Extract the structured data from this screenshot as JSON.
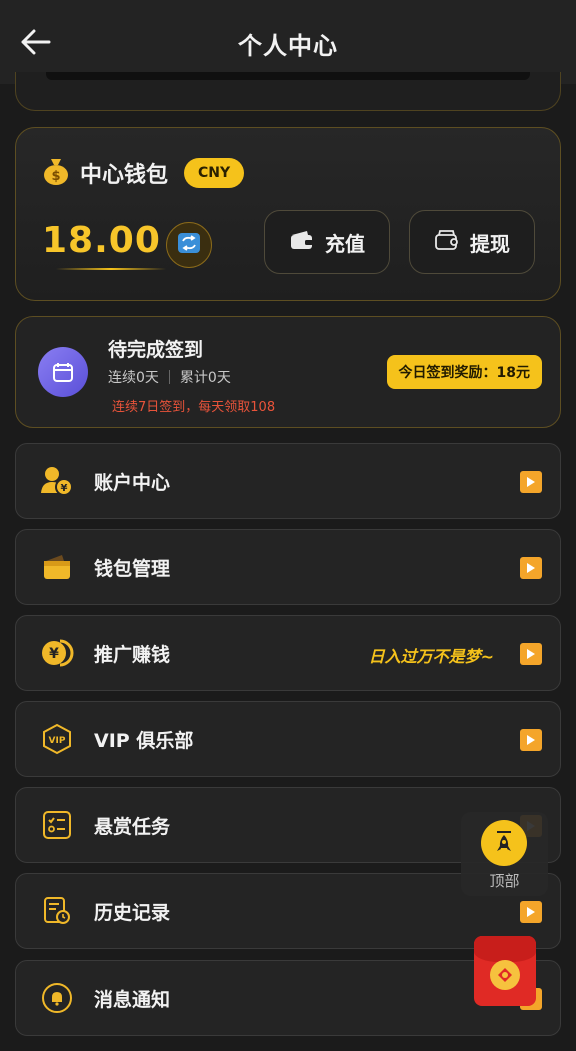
{
  "header": {
    "title": "个人中心",
    "back_icon": "arrow-left-icon"
  },
  "wallet": {
    "title": "中心钱包",
    "currency": "CNY",
    "balance": "18.00",
    "recharge_label": "充值",
    "withdraw_label": "提现",
    "accent": "#f5c21b"
  },
  "checkin": {
    "title": "待完成签到",
    "streak": "连续0天",
    "total": "累计0天",
    "tip": "连续7日签到，每天领取108",
    "reward": "今日签到奖励：18元"
  },
  "menu": [
    {
      "label": "账户中心",
      "icon": "user-yen-icon"
    },
    {
      "label": "钱包管理",
      "icon": "wallet-icon"
    },
    {
      "label": "推广赚钱",
      "icon": "yen-coin-icon",
      "slogan": "日入过万不是梦~"
    },
    {
      "label": "VIP 俱乐部",
      "icon": "vip-badge-icon"
    },
    {
      "label": "悬赏任务",
      "icon": "task-list-icon"
    },
    {
      "label": "历史记录",
      "icon": "history-icon"
    },
    {
      "label": "消息通知",
      "icon": "bell-icon"
    }
  ],
  "float_top": {
    "label": "顶部"
  }
}
